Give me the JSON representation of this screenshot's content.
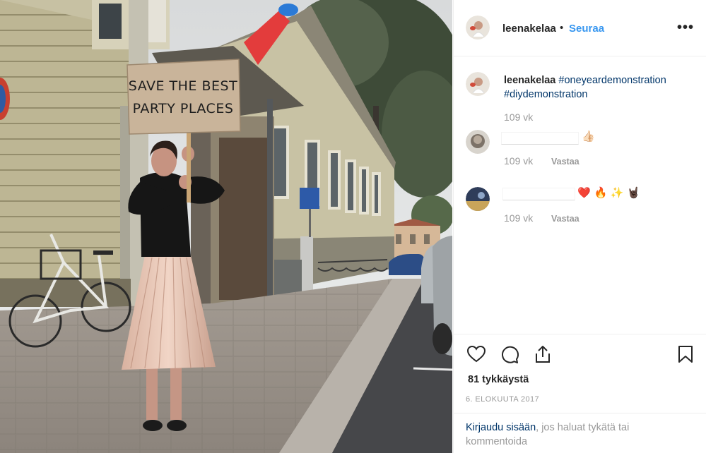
{
  "post": {
    "username": "leenakelaa",
    "separator": "•",
    "follow_label": "Seuraa",
    "more_label": "•••"
  },
  "photo": {
    "sign_line1": "SAVE THE BEST",
    "sign_line2": "PARTY PLACES"
  },
  "caption": {
    "username": "leenakelaa",
    "hashtags": [
      "#oneyeardemonstration",
      "#diydemonstration"
    ],
    "age": "109 vk"
  },
  "comments": [
    {
      "emoji": "👍🏻",
      "age": "109 vk",
      "reply_label": "Vastaa"
    },
    {
      "emoji": "❤️ 🔥 ✨ 🤘🏿",
      "age": "109 vk",
      "reply_label": "Vastaa"
    }
  ],
  "actions": {
    "like_icon": "heart-icon",
    "comment_icon": "comment-icon",
    "share_icon": "share-icon",
    "save_icon": "bookmark-icon"
  },
  "likes": "81 tykkäystä",
  "date": "6. ELOKUUTA 2017",
  "login": {
    "link_text": "Kirjaudu sisään",
    "rest_text": ", jos haluat tykätä tai kommentoida"
  },
  "colors": {
    "follow": "#3897f0",
    "hashtag": "#003569",
    "muted": "#999999",
    "heart_emoji": "#e0245e"
  }
}
